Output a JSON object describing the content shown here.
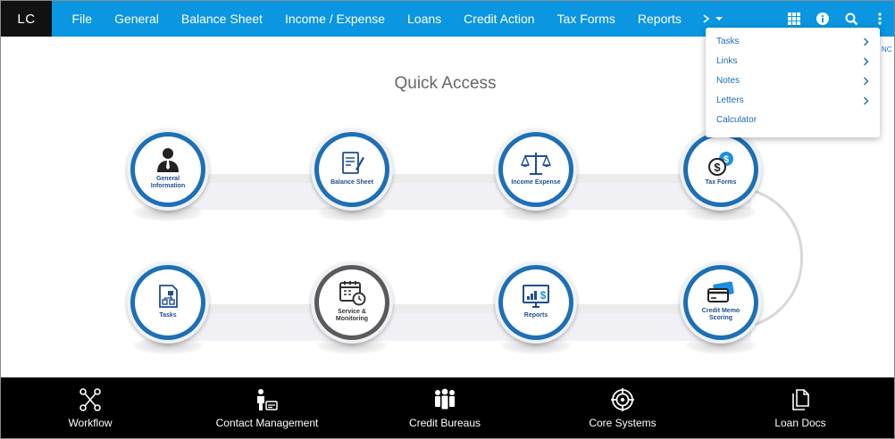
{
  "app": {
    "logo": "LC"
  },
  "nav": {
    "items": [
      "File",
      "General",
      "Balance Sheet",
      "Income / Expense",
      "Loans",
      "Credit Action",
      "Tax Forms",
      "Reports"
    ],
    "more_icon": "chevron-right-caret-down"
  },
  "header_icons": [
    "grid-icon",
    "info-icon",
    "search-icon",
    "kebab-icon"
  ],
  "dropdown": {
    "items": [
      {
        "label": "Tasks",
        "has_submenu": true
      },
      {
        "label": "Links",
        "has_submenu": true
      },
      {
        "label": "Notes",
        "has_submenu": true
      },
      {
        "label": "Letters",
        "has_submenu": true
      },
      {
        "label": "Calculator",
        "has_submenu": false
      }
    ]
  },
  "edge_text": "NC",
  "main": {
    "title": "Quick Access",
    "tiles": [
      {
        "label": "General Information",
        "icon": "user-icon"
      },
      {
        "label": "Balance Sheet",
        "icon": "document-pen-icon"
      },
      {
        "label": "Income Expense",
        "icon": "scale-icon"
      },
      {
        "label": "Tax Forms",
        "icon": "dollar-coins-icon"
      },
      {
        "label": "Tasks",
        "icon": "flowchart-doc-icon"
      },
      {
        "label": "Service & Monitoring",
        "icon": "calendar-clock-icon"
      },
      {
        "label": "Reports",
        "icon": "monitor-chart-icon"
      },
      {
        "label": "Credit Memo Scoring",
        "icon": "credit-cards-icon"
      }
    ]
  },
  "bottom": {
    "items": [
      {
        "label": "Workflow",
        "icon": "workflow-icon"
      },
      {
        "label": "Contact Management",
        "icon": "contact-icon"
      },
      {
        "label": "Credit Bureaus",
        "icon": "people-group-icon"
      },
      {
        "label": "Core Systems",
        "icon": "target-icon"
      },
      {
        "label": "Loan Docs",
        "icon": "documents-icon"
      }
    ]
  },
  "colors": {
    "nav_bg": "#0a96e0",
    "logo_bg": "#111111",
    "tile_blue": "#1d6fb6",
    "tile_gray": "#5a5a5a",
    "link": "#1a6db5",
    "bottom_bg": "#000000"
  }
}
